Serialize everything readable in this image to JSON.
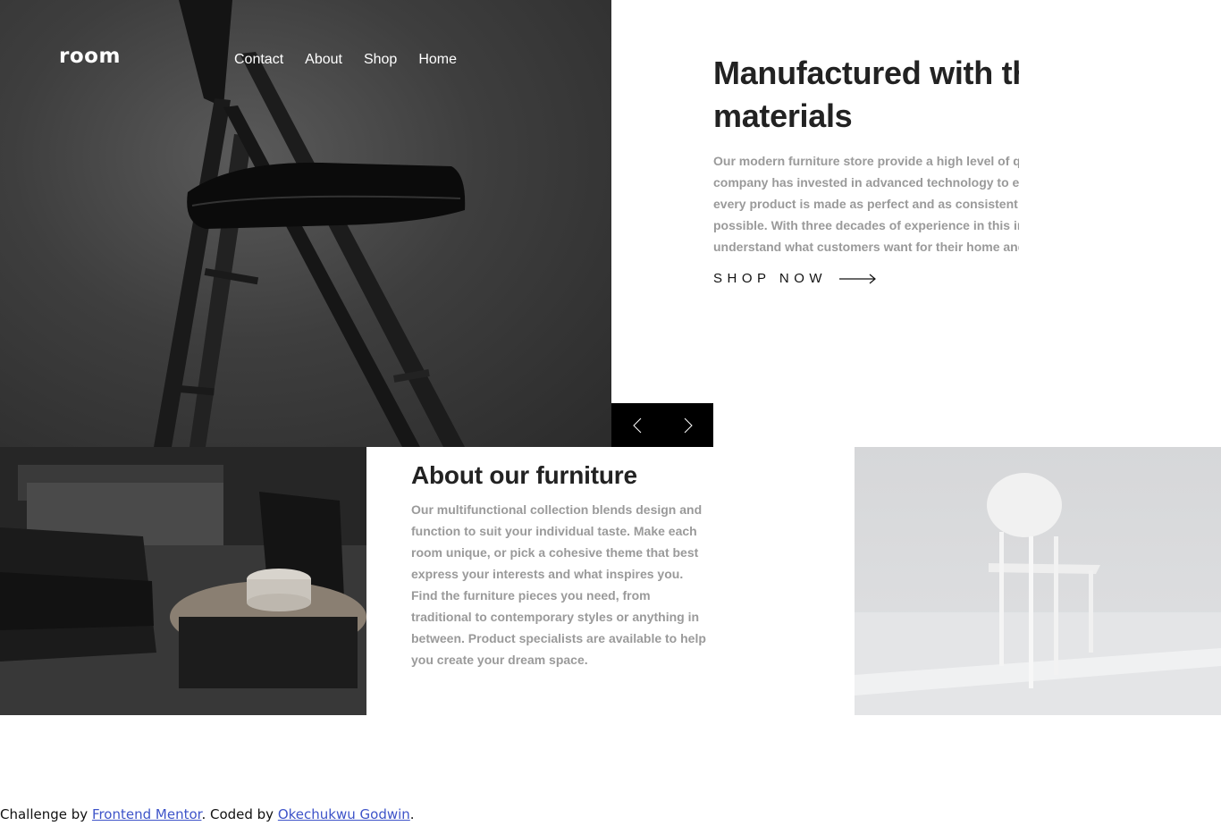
{
  "header": {
    "logo": "room",
    "nav": [
      {
        "label": "Contact"
      },
      {
        "label": "About"
      },
      {
        "label": "Shop"
      },
      {
        "label": "Home"
      }
    ]
  },
  "hero": {
    "title": "Manufactured with the best materials",
    "description": "Our modern furniture store provide a high level of quality. Our company has invested in advanced technology to ensure that every product is made as perfect and as consistent as possible. With three decades of experience in this industry, we understand what customers want for their home and office.",
    "cta_label": "SHOP NOW",
    "cta_icon": "arrow-right-icon"
  },
  "slider": {
    "prev_icon": "chevron-left-icon",
    "next_icon": "chevron-right-icon"
  },
  "about": {
    "title": "About our furniture",
    "description": "Our multifunctional collection blends design and function to suit your individual taste. Make each room unique, or pick a cohesive theme that best express your interests and what inspires you. Find the furniture pieces you need, from traditional to contemporary styles or anything in between. Product specialists are available to help you create your dream space."
  },
  "attribution": {
    "prefix": "Challenge by ",
    "link1": "Frontend Mentor",
    "middle": ". Coded by ",
    "link2": "Okechukwu Godwin",
    "suffix": "."
  },
  "colors": {
    "text_dark": "#222222",
    "text_muted": "#9a9a9a",
    "slider_bg": "#000000",
    "link": "#3e54c9"
  }
}
